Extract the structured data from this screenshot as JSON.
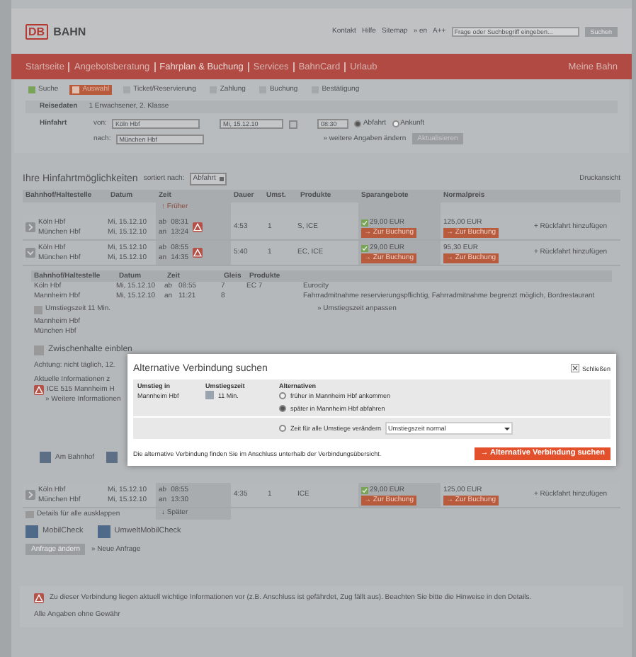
{
  "header": {
    "logo_mark": "DB",
    "logo_text": "BAHN",
    "links": [
      "Kontakt",
      "Hilfe",
      "Sitemap",
      "» en",
      "A++"
    ],
    "search": {
      "placeholder": "Frage oder Suchbegriff eingeben..."
    },
    "search_button": "Suchen"
  },
  "nav": {
    "items": [
      {
        "label": "Startseite",
        "selected": false
      },
      {
        "label": "Angebotsberatung",
        "selected": false
      },
      {
        "label": "Fahrplan & Buchung",
        "selected": true
      },
      {
        "label": "Services",
        "selected": false
      },
      {
        "label": "BahnCard",
        "selected": false
      },
      {
        "label": "Urlaub",
        "selected": false
      }
    ],
    "right": "Meine Bahn"
  },
  "steps": [
    {
      "label": "Suche",
      "done": true,
      "selected": false
    },
    {
      "label": "Auswahl",
      "done": false,
      "selected": true
    },
    {
      "label": "Ticket/Reservierung",
      "done": false,
      "selected": false
    },
    {
      "label": "Zahlung",
      "done": false,
      "selected": false
    },
    {
      "label": "Buchung",
      "done": false,
      "selected": false
    },
    {
      "label": "Bestätigung",
      "done": false,
      "selected": false
    }
  ],
  "travel": {
    "label": "Reisedaten",
    "value": "1 Erwachsener, 2. Klasse"
  },
  "trip": {
    "label": "Hinfahrt",
    "from_label": "von:",
    "from": "Köln Hbf",
    "to_label": "nach:",
    "to": "München Hbf",
    "date": "Mi, 15.12.10",
    "time": "08:30",
    "modes": [
      {
        "label": "Abfahrt",
        "selected": true
      },
      {
        "label": "Ankunft",
        "selected": false
      }
    ],
    "more_link": "» weitere Angaben ändern",
    "update_button": "Aktualisieren"
  },
  "results": {
    "title": "Ihre Hinfahrtmöglichkeiten",
    "sort_label": "sortiert nach:",
    "sort_value": "Abfahrt",
    "print_link": "Druckansicht",
    "columns": [
      "Bahnhof/Haltestelle",
      "Datum",
      "Zeit",
      "Dauer",
      "Umst.",
      "Produkte",
      "Sparangebote",
      "Normalpreis"
    ],
    "earlier": "↑ Früher",
    "later": "↓ Später",
    "connections": [
      {
        "stations": [
          "Köln Hbf",
          "München Hbf"
        ],
        "dates": [
          "Mi, 15.12.10",
          "Mi, 15.12.10"
        ],
        "dirs": [
          "ab",
          "an"
        ],
        "times": [
          "08:31",
          "13:24"
        ],
        "duration": "4:53",
        "changes": "1",
        "products": "S, ICE",
        "saver_price": "29,00 EUR",
        "saver_book": "→ Zur Buchung",
        "normal_price": "125,00 EUR",
        "normal_book": "→ Zur Buchung",
        "return_link": "+ Rückfahrt hinzufügen",
        "warning": true,
        "expanded": false
      },
      {
        "stations": [
          "Köln Hbf",
          "München Hbf"
        ],
        "dates": [
          "Mi, 15.12.10",
          "Mi, 15.12.10"
        ],
        "dirs": [
          "ab",
          "an"
        ],
        "times": [
          "08:55",
          "14:35"
        ],
        "duration": "5:40",
        "changes": "1",
        "products": "EC, ICE",
        "saver_price": "29,00 EUR",
        "saver_book": "→ Zur Buchung",
        "normal_price": "95,30 EUR",
        "normal_book": "→ Zur Buchung",
        "return_link": "+ Rückfahrt hinzufügen",
        "warning": true,
        "expanded": true
      },
      {
        "stations": [
          "Köln Hbf",
          "München Hbf"
        ],
        "dates": [
          "Mi, 15.12.10",
          "Mi, 15.12.10"
        ],
        "dirs": [
          "ab",
          "an"
        ],
        "times": [
          "08:55",
          "13:30"
        ],
        "duration": "4:35",
        "changes": "1",
        "products": "ICE",
        "saver_price": "29,00 EUR",
        "saver_book": "→ Zur Buchung",
        "normal_price": "125,00 EUR",
        "normal_book": "→ Zur Buchung",
        "return_link": "+ Rückfahrt hinzufügen",
        "warning": false,
        "expanded": false
      }
    ]
  },
  "detail": {
    "columns": [
      "Bahnhof/Haltestelle",
      "Datum",
      "Zeit",
      "Gleis",
      "Produkte"
    ],
    "legs": [
      {
        "station": "Köln Hbf",
        "date": "Mi, 15.12.10",
        "dir": "ab",
        "time": "08:55",
        "track": "7",
        "product": "EC 7"
      },
      {
        "station": "Mannheim Hbf",
        "date": "Mi, 15.12.10",
        "dir": "an",
        "time": "11:21",
        "track": "8"
      }
    ],
    "train_name": "Eurocity",
    "train_notes": "Fahrradmitnahme reservierungspflichtig, Fahrradmitnahme begrenzt möglich, Bordrestaurant",
    "transfer": "Umstiegszeit 11 Min.",
    "transfer_link": "» Umstiegszeit anpassen",
    "next_stations": [
      "Mannheim Hbf",
      "München Hbf"
    ],
    "stops": "Zwischenhalte einblen",
    "notice": "Achtung: nicht täglich, 12.",
    "info_title": "Aktuelle Informationen z",
    "info_item": "ICE 515 Mannheim H",
    "info_link": "» Weitere Informationen",
    "links": [
      "Am Bahnhof"
    ]
  },
  "actions": {
    "details_all": "Details für alle ausklappen",
    "checks": [
      "MobilCheck",
      "UmweltMobilCheck"
    ],
    "change_button": "Anfrage ändern",
    "new_link": "» Neue Anfrage"
  },
  "notice": {
    "text": "Zu dieser Verbindung liegen aktuell wichtige Informationen vor (z.B. Anschluss ist gefährdet, Zug fällt aus). Beachten Sie bitte die Hinweise in den Details.",
    "disclaimer": "Alle Angaben ohne Gewähr"
  },
  "dialog": {
    "title": "Alternative Verbindung suchen",
    "close": "Schließen",
    "columns": [
      "Umstieg in",
      "Umstiegszeit",
      "Alternativen"
    ],
    "station": "Mannheim Hbf",
    "time": "11 Min.",
    "options": [
      {
        "label": "früher in Mannheim Hbf ankommen",
        "selected": false
      },
      {
        "label": "später in Mannheim Hbf abfahren",
        "selected": true
      },
      {
        "label": "Zeit für alle Umstiege verändern",
        "selected": false
      }
    ],
    "select_value": "Umstiegszeit normal",
    "hint": "Die alternative Verbindung finden Sie im Anschluss unterhalb der Verbindungsübersicht.",
    "submit": "→ Alternative Verbindung suchen"
  }
}
